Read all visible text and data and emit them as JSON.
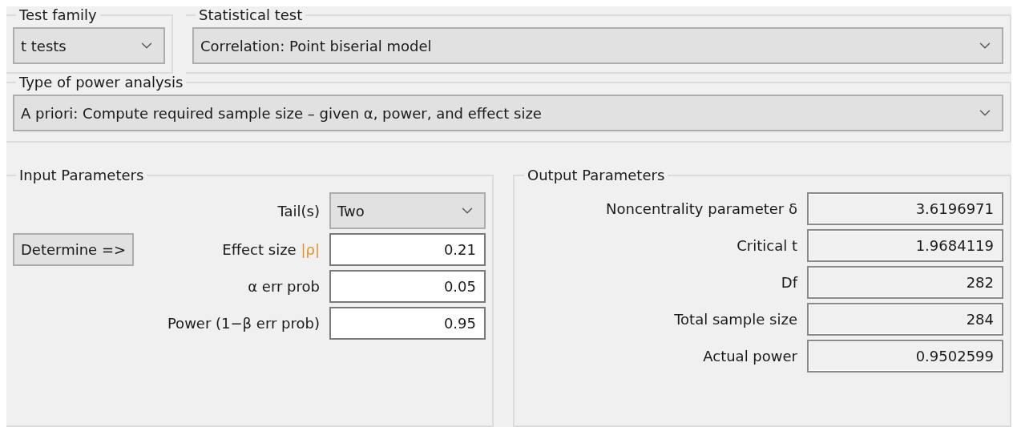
{
  "test_family": {
    "label": "Test family",
    "value": "t tests"
  },
  "statistical_test": {
    "label": "Statistical test",
    "value": "Correlation: Point biserial model"
  },
  "power_analysis_type": {
    "label": "Type of power analysis",
    "value": "A priori: Compute required sample size – given α, power, and effect size"
  },
  "input_parameters": {
    "title": "Input Parameters",
    "determine_button": "Determine =>",
    "rows": [
      {
        "kind": "dropdown",
        "label": "Tail(s)",
        "value": "Two"
      },
      {
        "kind": "input",
        "label": "Effect size",
        "symbol": "|ρ|",
        "value": "0.21"
      },
      {
        "kind": "input",
        "label": "α err prob",
        "value": "0.05"
      },
      {
        "kind": "input",
        "label": "Power (1−β err prob)",
        "value": "0.95"
      }
    ]
  },
  "output_parameters": {
    "title": "Output Parameters",
    "rows": [
      {
        "label": "Noncentrality parameter δ",
        "value": "3.6196971"
      },
      {
        "label": "Critical t",
        "value": "1.9684119"
      },
      {
        "label": "Df",
        "value": "282"
      },
      {
        "label": "Total sample size",
        "value": "284"
      },
      {
        "label": "Actual power",
        "value": "0.9502599"
      }
    ]
  }
}
